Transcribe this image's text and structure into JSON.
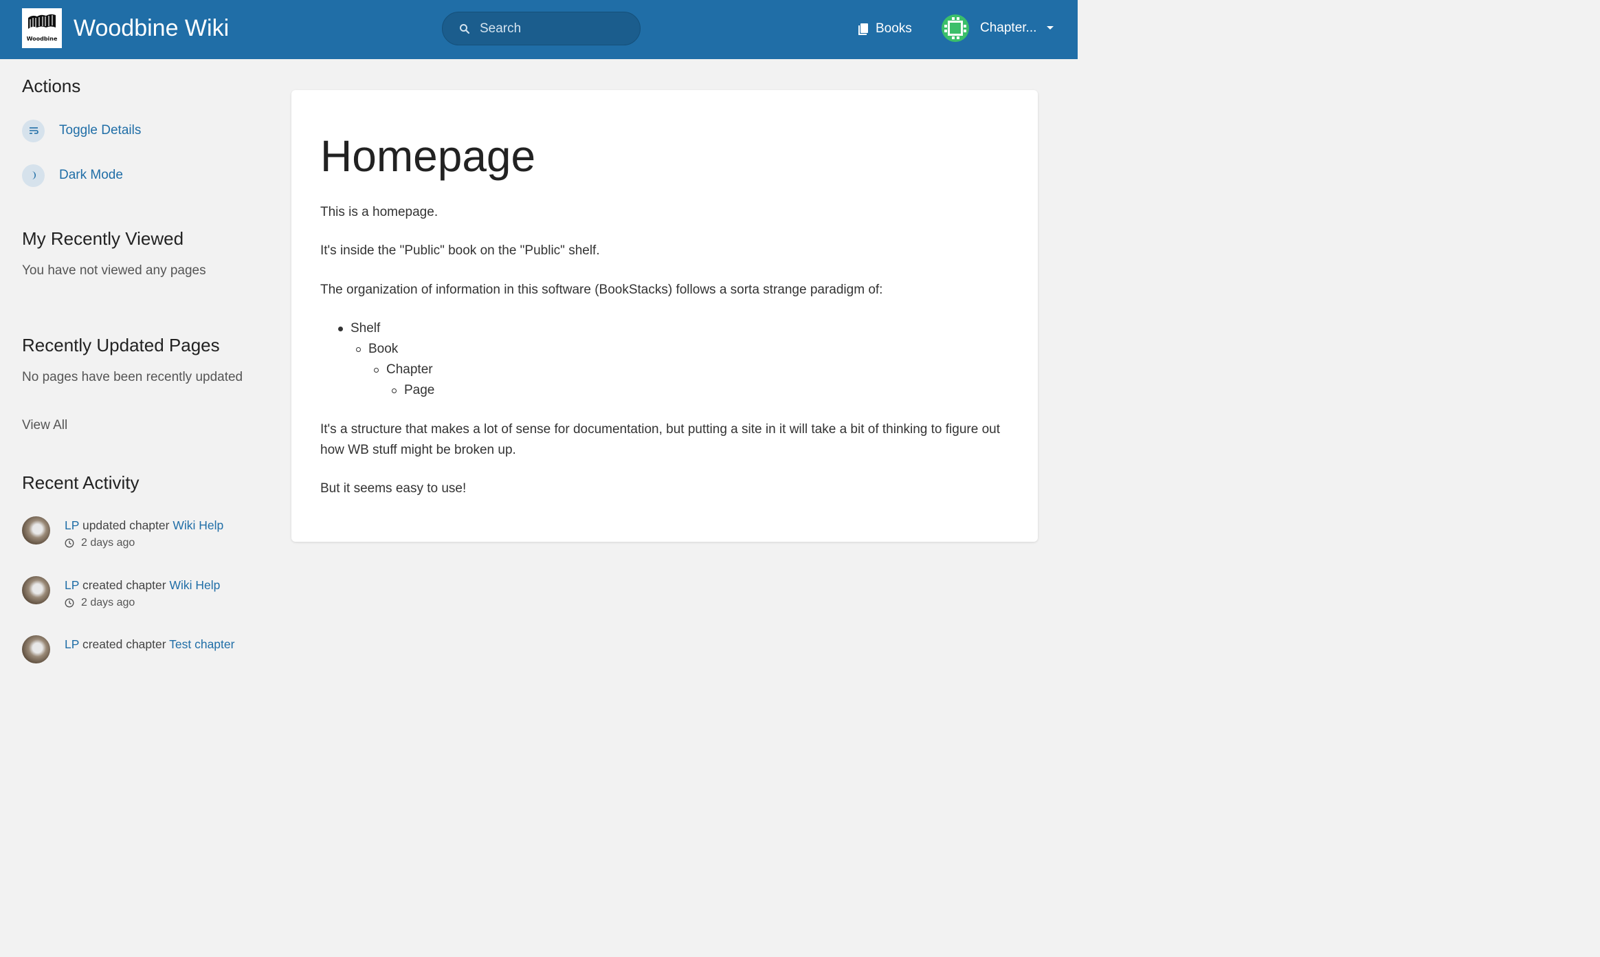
{
  "header": {
    "logo_text": "Woodbine",
    "site_title": "Woodbine Wiki",
    "search_placeholder": "Search",
    "books_label": "Books",
    "user_label": "Chapter..."
  },
  "sidebar": {
    "actions_heading": "Actions",
    "actions": [
      {
        "label": "Toggle Details",
        "icon": "toggle-details-icon"
      },
      {
        "label": "Dark Mode",
        "icon": "moon-icon"
      }
    ],
    "recently_viewed_heading": "My Recently Viewed",
    "recently_viewed_empty": "You have not viewed any pages",
    "recently_updated_heading": "Recently Updated Pages",
    "recently_updated_empty": "No pages have been recently updated",
    "view_all_label": "View All",
    "recent_activity_heading": "Recent Activity",
    "activity": [
      {
        "user": "LP",
        "action": "updated chapter",
        "target": "Wiki Help",
        "time": "2 days ago"
      },
      {
        "user": "LP",
        "action": "created chapter",
        "target": "Wiki Help",
        "time": "2 days ago"
      },
      {
        "user": "LP",
        "action": "created chapter",
        "target": "Test chapter",
        "time": ""
      }
    ]
  },
  "page": {
    "title": "Homepage",
    "paragraphs": [
      "This is a homepage.",
      "It's inside the \"Public\" book on the \"Public\" shelf.",
      "The organization of information in this software (BookStacks) follows a sorta strange paradigm of:",
      "It's a structure that makes a lot of sense for documentation, but putting a site in it will take a bit of thinking to figure out how WB stuff might be broken up.",
      "But it seems easy to use!"
    ],
    "hierarchy": [
      "Shelf",
      "Book",
      "Chapter",
      "Page"
    ]
  },
  "colors": {
    "header_bg": "#206ea7",
    "link": "#206ea7",
    "page_bg": "#f2f2f2"
  }
}
